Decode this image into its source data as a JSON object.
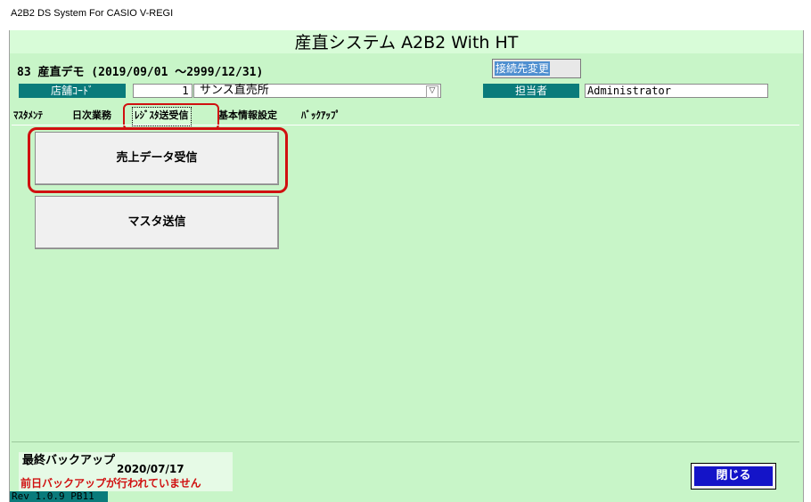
{
  "window": {
    "title": "A2B2 DS System For CASIO V-REGI"
  },
  "header": {
    "title": "産直システム A2B2 With HT"
  },
  "info": {
    "store_line": "83 産直デモ (2019/09/01 ～2999/12/31)",
    "connection_button": "接続先変更",
    "store_code_label": "店舗ｺｰﾄﾞ",
    "store_code_value": "1",
    "store_name": "サンス直売所",
    "staff_label": "担当者",
    "staff_value": "Administrator"
  },
  "tabs": [
    {
      "label": "ﾏｽﾀﾒﾝﾃ"
    },
    {
      "label": "日次業務"
    },
    {
      "label": "ﾚｼﾞｽﾀ送受信"
    },
    {
      "label": "基本情報設定"
    },
    {
      "label": "ﾊﾞｯｸｱｯﾌﾟ"
    }
  ],
  "actions": {
    "receive_sales": "売上データ受信",
    "send_master": "マスタ送信"
  },
  "footer": {
    "backup_title": "最終バックアップ",
    "backup_date": "2020/07/17",
    "backup_warning": "前日バックアップが行われていません",
    "close_button": "閉じる",
    "version": "Rev 1.0.9 PB11"
  },
  "colors": {
    "background": "#c8f5c8",
    "label_bg": "#0a7b7b",
    "highlight": "#d01010",
    "close_btn": "#1414c8"
  }
}
